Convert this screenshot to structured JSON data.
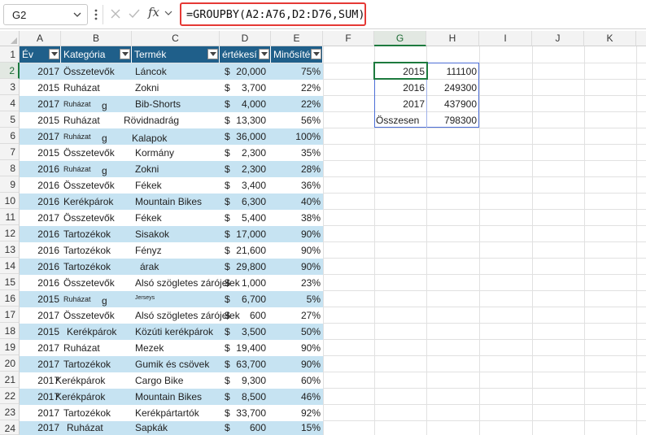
{
  "formula_bar": {
    "name_box": "G2",
    "fx_label": "fx",
    "formula": "=GROUPBY(A2:A76,D2:D76,SUM)"
  },
  "columns": [
    "A",
    "B",
    "C",
    "D",
    "E",
    "F",
    "G",
    "H",
    "I",
    "J",
    "K"
  ],
  "rows": [
    "1",
    "2",
    "3",
    "4",
    "5",
    "6",
    "7",
    "8",
    "9",
    "10",
    "11",
    "12",
    "13",
    "14",
    "15",
    "16",
    "17",
    "18",
    "19",
    "20",
    "21",
    "22",
    "23",
    "24"
  ],
  "table": {
    "headers": [
      "Év",
      "Kategória",
      "Termék",
      "értékesí",
      "Minősíté"
    ],
    "rows": [
      {
        "year": "2017",
        "category": "Összetevők",
        "product": "Láncok",
        "cur": "$",
        "amount": "20,000",
        "pct": "75%"
      },
      {
        "year": "2015",
        "category": "Ruházat",
        "product": "Zokni",
        "cur": "$",
        "amount": "3,700",
        "pct": "22%"
      },
      {
        "year": "2017",
        "category": "Ruházat",
        "category_extra": "g",
        "product": "Bib-Shorts",
        "cur": "$",
        "amount": "4,000",
        "pct": "22%"
      },
      {
        "year": "2015",
        "category": "Ruházat",
        "product": "Rövidnadrág",
        "cur": "$",
        "amount": "13,300",
        "pct": "56%"
      },
      {
        "year": "2017",
        "category": "Ruházat",
        "category_extra": "g",
        "product": "Kalapok",
        "cur": "$",
        "amount": "36,000",
        "pct": "100%"
      },
      {
        "year": "2015",
        "category": "Összetevők",
        "product": "Kormány",
        "cur": "$",
        "amount": "2,300",
        "pct": "35%"
      },
      {
        "year": "2016",
        "category": "Ruházat",
        "category_extra": "g",
        "product": "Zokni",
        "cur": "$",
        "amount": "2,300",
        "pct": "28%"
      },
      {
        "year": "2016",
        "category": "Összetevők",
        "product": "Fékek",
        "cur": "$",
        "amount": "3,400",
        "pct": "36%"
      },
      {
        "year": "2016",
        "category": "Kerékpárok",
        "product": "Mountain Bikes",
        "cur": "$",
        "amount": "6,300",
        "pct": "40%"
      },
      {
        "year": "2017",
        "category": "Összetevők",
        "product": "Fékek",
        "cur": "$",
        "amount": "5,400",
        "pct": "38%"
      },
      {
        "year": "2016",
        "category": "Tartozékok",
        "product": "Sisakok",
        "cur": "$",
        "amount": "17,000",
        "pct": "90%"
      },
      {
        "year": "2016",
        "category": "Tartozékok",
        "product": "Fényz",
        "cur": "$",
        "amount": "21,600",
        "pct": "90%"
      },
      {
        "year": "2016",
        "category": "Tartozékok",
        "product": "árak",
        "cur": "$",
        "amount": "29,800",
        "pct": "90%"
      },
      {
        "year": "2016",
        "category": "Összetevők",
        "product": "Alsó szögletes zárójelek",
        "cur": "$",
        "amount": "1,000",
        "pct": "23%"
      },
      {
        "year": "2015",
        "category": "Ruházat",
        "category_extra": "g",
        "product": "Jerseys",
        "cur": "$",
        "amount": "6,700",
        "pct": "5%"
      },
      {
        "year": "2017",
        "category": "Összetevők",
        "product": "Alsó szögletes zárójelek",
        "cur": "$",
        "amount": "600",
        "pct": "27%"
      },
      {
        "year": "2015",
        "category": "Kerékpárok",
        "product": "Közúti kerékpárok",
        "cur": "$",
        "amount": "3,500",
        "pct": "50%"
      },
      {
        "year": "2017",
        "category": "Ruházat",
        "product": "Mezek",
        "cur": "$",
        "amount": "19,400",
        "pct": "90%"
      },
      {
        "year": "2017",
        "category": "Tartozékok",
        "product": "Gumik és csövek",
        "cur": "$",
        "amount": "63,700",
        "pct": "90%"
      },
      {
        "year": "2017",
        "category": "Kerékpárok",
        "product": "Cargo Bike",
        "cur": "$",
        "amount": "9,300",
        "pct": "60%"
      },
      {
        "year": "2017",
        "category": "Kerékpárok",
        "product": "Mountain Bikes",
        "cur": "$",
        "amount": "8,500",
        "pct": "46%"
      },
      {
        "year": "2017",
        "category": "Tartozékok",
        "product": "Kerékpártartók",
        "cur": "$",
        "amount": "33,700",
        "pct": "92%"
      },
      {
        "year": "2017",
        "category": "Ruházat",
        "product": "Sapkák",
        "cur": "$",
        "amount": "600",
        "pct": "15%"
      }
    ]
  },
  "result": [
    {
      "label": "2015",
      "value": "111100"
    },
    {
      "label": "2016",
      "value": "249300"
    },
    {
      "label": "2017",
      "value": "437900"
    },
    {
      "label": "Összesen",
      "value": "798300"
    }
  ],
  "colors": {
    "table_header": "#1f5f8a",
    "band": "#c6e3f2",
    "formula_highlight": "#e53935",
    "selection": "#1d7a3e",
    "spill_border": "#4d6fd6"
  }
}
